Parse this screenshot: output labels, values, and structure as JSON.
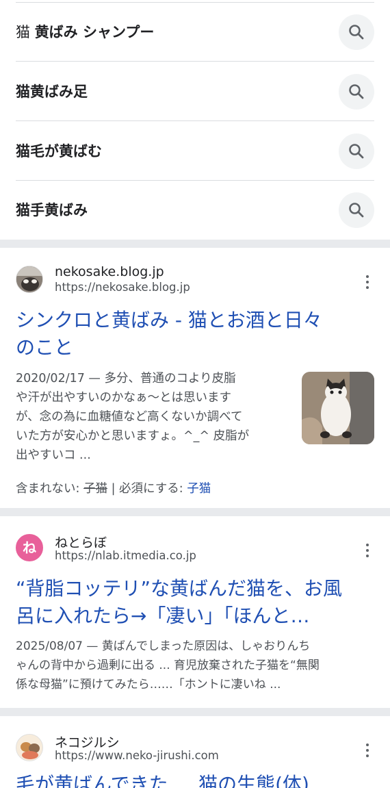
{
  "related_searches": [
    {
      "prefix": "猫 ",
      "bold": "黄ばみ シャンプー"
    },
    {
      "prefix": "",
      "bold": "猫黄ばみ足"
    },
    {
      "prefix": "",
      "bold": "猫毛が黄ばむ"
    },
    {
      "prefix": "",
      "bold": "猫手黄ばみ"
    }
  ],
  "results": [
    {
      "site_name": "nekosake.blog.jp",
      "url": "https://nekosake.blog.jp",
      "title_line1": "シンクロと黄ばみ - 猫とお酒と日々",
      "title_line2": "のこと",
      "snippet_lines": [
        "2020/02/17 — 多分、普通のコより皮脂",
        "や汗が出やすいのかなぁ～とは思います",
        "が、念の為に血糖値など高くないか調べて",
        "いた方が安心かと思いますょ。^_^ 皮脂が",
        "出やすいコ ..."
      ],
      "missing_label": "含まれない:",
      "missing_term": "子猫",
      "separator": "|",
      "must_include_label": "必須にする:",
      "must_include_term": "子猫"
    },
    {
      "site_name": "ねとらぼ",
      "url": "https://nlab.itmedia.co.jp",
      "favicon_char": "ね",
      "title_line1": "“背脂コッテリ”な黄ばんだ猫を、お風",
      "title_line2": "呂に入れたら→「凄い」「ほんと…",
      "snippet_lines": [
        "2025/08/07 — 黄ばんでしまった原因は、しゃおりんち",
        "ゃんの背中から過剰に出る ... 育児放棄された子猫を“無関",
        "係な母猫”に預けてみたら……「ホントに凄いね ..."
      ]
    },
    {
      "site_name": "ネコジルシ",
      "url": "https://www.neko-jirushi.com",
      "title_line1": "毛が黄ばんできた ... 猫の生態(体)"
    }
  ],
  "colors": {
    "link": "#1f4fb3",
    "divider": "#e8eaed",
    "secondary_text": "#4d5156",
    "netorabo_favicon": "#e8609a"
  },
  "icons": {
    "related_search_button": "search-icon",
    "result_menu": "more-vert-icon"
  }
}
